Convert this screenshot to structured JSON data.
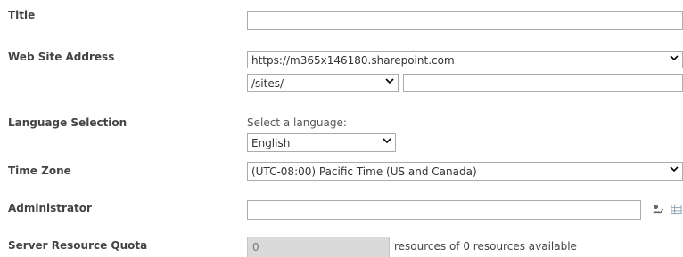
{
  "form": {
    "title": {
      "label": "Title",
      "value": ""
    },
    "web_site_address": {
      "label": "Web Site Address",
      "domain_selected": "https://m365x146180.sharepoint.com",
      "path_selected": "/sites/",
      "url_value": ""
    },
    "language": {
      "label": "Language Selection",
      "hint": "Select a language:",
      "selected": "English"
    },
    "time_zone": {
      "label": "Time Zone",
      "selected": "(UTC-08:00) Pacific Time (US and Canada)"
    },
    "administrator": {
      "label": "Administrator",
      "value": "",
      "icons": [
        "check-names-icon",
        "browse-icon"
      ]
    },
    "server_resource_quota": {
      "label": "Server Resource Quota",
      "value": "0",
      "suffix": "resources of 0 resources available"
    }
  }
}
